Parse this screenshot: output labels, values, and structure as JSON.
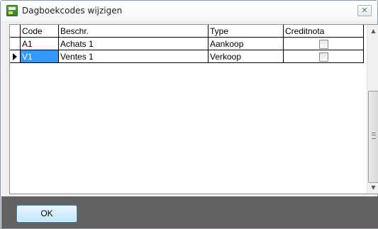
{
  "window": {
    "title": "Dagboekcodes wijzigen",
    "close_glyph": "✕"
  },
  "grid": {
    "columns": [
      "Code",
      "Beschr.",
      "Type",
      "Creditnota"
    ],
    "rows": [
      {
        "code": "A1",
        "description": "Achats 1",
        "type": "Aankoop",
        "creditnota": false,
        "current": false
      },
      {
        "code": "V1",
        "description": "Ventes 1",
        "type": "Verkoop",
        "creditnota": false,
        "current": true
      }
    ]
  },
  "footer": {
    "ok_label": "OK"
  },
  "colors": {
    "selection": "#3399ff",
    "footer_bg": "#636363",
    "button_border": "#3c7fb1"
  },
  "icons": {
    "app": "app-icon",
    "close": "close-icon",
    "row_indicator": "row-pointer-icon",
    "scroll_up": "scroll-up-icon",
    "scroll_down": "scroll-down-icon"
  }
}
